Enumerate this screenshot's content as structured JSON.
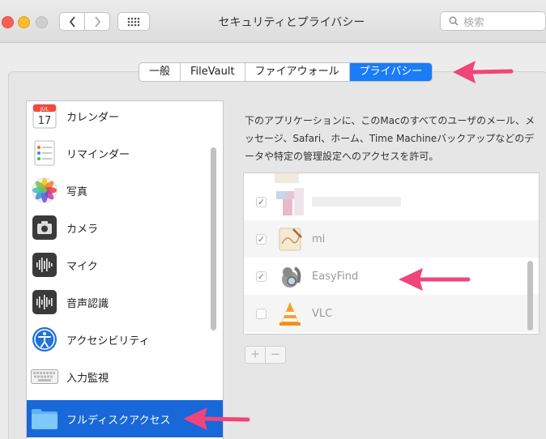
{
  "window": {
    "title": "セキュリティとプライバシー",
    "search_placeholder": "検索"
  },
  "tabs": [
    {
      "label": "一般",
      "active": false
    },
    {
      "label": "FileVault",
      "active": false
    },
    {
      "label": "ファイアウォール",
      "active": false
    },
    {
      "label": "プライバシー",
      "active": true
    }
  ],
  "sidebar": {
    "items": [
      {
        "label": "カレンダー",
        "icon": "calendar-icon",
        "calendar_month": "JUL",
        "calendar_day": "17"
      },
      {
        "label": "リマインダー",
        "icon": "reminders-icon"
      },
      {
        "label": "写真",
        "icon": "photos-icon"
      },
      {
        "label": "カメラ",
        "icon": "camera-icon"
      },
      {
        "label": "マイク",
        "icon": "microphone-icon"
      },
      {
        "label": "音声認識",
        "icon": "speech-recognition-icon"
      },
      {
        "label": "アクセシビリティ",
        "icon": "accessibility-icon"
      },
      {
        "label": "入力監視",
        "icon": "keyboard-icon"
      },
      {
        "label": "フルディスクアクセス",
        "icon": "folder-icon",
        "selected": true
      }
    ]
  },
  "main": {
    "description": "下のアプリケーションに、このMacのすべてのユーザのメール、メッセージ、Safari、ホーム、Time Machineバックアップなどのデータや特定の管理設定へのアクセスを許可。",
    "apps": [
      {
        "name": "",
        "checked": true,
        "icon": "blurred-app-icon"
      },
      {
        "name": "mi",
        "checked": true,
        "icon": "mi-app-icon"
      },
      {
        "name": "EasyFind",
        "checked": true,
        "icon": "easyfind-app-icon"
      },
      {
        "name": "VLC",
        "checked": false,
        "icon": "vlc-app-icon"
      }
    ],
    "add_label": "+",
    "remove_label": "−"
  },
  "colors": {
    "accent": "#1a7cf6",
    "selection": "#1868d9",
    "annotation_arrow": "#f0457a"
  }
}
